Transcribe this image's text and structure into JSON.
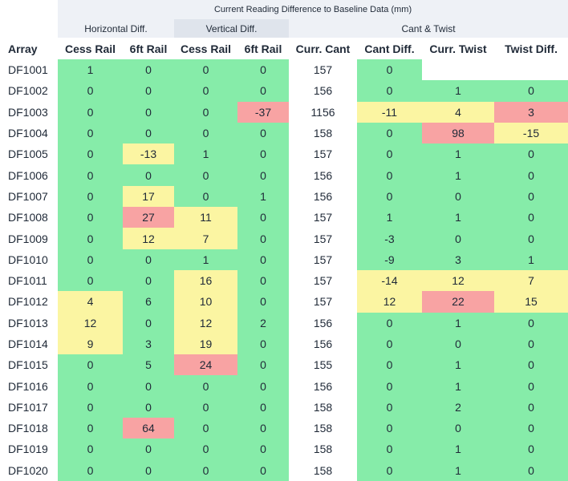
{
  "title": "Current Reading Difference to Baseline Data (mm)",
  "groups": {
    "horizontal": "Horizontal Diff.",
    "vertical": "Vertical Diff.",
    "cant_twist": "Cant & Twist"
  },
  "columns": [
    "Array",
    "Cess Rail",
    "6ft Rail",
    "Cess Rail",
    "6ft Rail",
    "Curr. Cant",
    "Cant Diff.",
    "Curr. Twist",
    "Twist Diff."
  ],
  "colors": {
    "ok": "#86eca9",
    "warn": "#fbf5a2",
    "alarm": "#f8a3a3",
    "none": "#ffffff"
  },
  "rows": [
    {
      "array": "DF1001",
      "values": [
        "1",
        "0",
        "0",
        "0",
        "157",
        "0",
        "",
        ""
      ],
      "status": [
        "g",
        "g",
        "g",
        "g",
        "w",
        "g",
        "w",
        "w"
      ]
    },
    {
      "array": "DF1002",
      "values": [
        "0",
        "0",
        "0",
        "0",
        "156",
        "0",
        "1",
        "0"
      ],
      "status": [
        "g",
        "g",
        "g",
        "g",
        "w",
        "g",
        "g",
        "g"
      ]
    },
    {
      "array": "DF1003",
      "values": [
        "0",
        "0",
        "0",
        "-37",
        "1156",
        "-11",
        "4",
        "3"
      ],
      "status": [
        "g",
        "g",
        "g",
        "r",
        "w",
        "y",
        "y",
        "r"
      ]
    },
    {
      "array": "DF1004",
      "values": [
        "0",
        "0",
        "0",
        "0",
        "158",
        "0",
        "98",
        "-15"
      ],
      "status": [
        "g",
        "g",
        "g",
        "g",
        "w",
        "g",
        "r",
        "y"
      ]
    },
    {
      "array": "DF1005",
      "values": [
        "0",
        "-13",
        "1",
        "0",
        "157",
        "0",
        "1",
        "0"
      ],
      "status": [
        "g",
        "y",
        "g",
        "g",
        "w",
        "g",
        "g",
        "g"
      ]
    },
    {
      "array": "DF1006",
      "values": [
        "0",
        "0",
        "0",
        "0",
        "156",
        "0",
        "1",
        "0"
      ],
      "status": [
        "g",
        "g",
        "g",
        "g",
        "w",
        "g",
        "g",
        "g"
      ]
    },
    {
      "array": "DF1007",
      "values": [
        "0",
        "17",
        "0",
        "1",
        "156",
        "0",
        "0",
        "0"
      ],
      "status": [
        "g",
        "y",
        "g",
        "g",
        "w",
        "g",
        "g",
        "g"
      ]
    },
    {
      "array": "DF1008",
      "values": [
        "0",
        "27",
        "11",
        "0",
        "157",
        "1",
        "1",
        "0"
      ],
      "status": [
        "g",
        "r",
        "y",
        "g",
        "w",
        "g",
        "g",
        "g"
      ]
    },
    {
      "array": "DF1009",
      "values": [
        "0",
        "12",
        "7",
        "0",
        "157",
        "-3",
        "0",
        "0"
      ],
      "status": [
        "g",
        "y",
        "y",
        "g",
        "w",
        "g",
        "g",
        "g"
      ]
    },
    {
      "array": "DF1010",
      "values": [
        "0",
        "0",
        "1",
        "0",
        "157",
        "-9",
        "3",
        "1"
      ],
      "status": [
        "g",
        "g",
        "g",
        "g",
        "w",
        "g",
        "g",
        "g"
      ]
    },
    {
      "array": "DF1011",
      "values": [
        "0",
        "0",
        "16",
        "0",
        "157",
        "-14",
        "12",
        "7"
      ],
      "status": [
        "g",
        "g",
        "y",
        "g",
        "w",
        "y",
        "y",
        "y"
      ]
    },
    {
      "array": "DF1012",
      "values": [
        "4",
        "6",
        "10",
        "0",
        "157",
        "12",
        "22",
        "15"
      ],
      "status": [
        "y",
        "g",
        "y",
        "g",
        "w",
        "y",
        "r",
        "y"
      ]
    },
    {
      "array": "DF1013",
      "values": [
        "12",
        "0",
        "12",
        "2",
        "156",
        "0",
        "1",
        "0"
      ],
      "status": [
        "y",
        "g",
        "y",
        "g",
        "w",
        "g",
        "g",
        "g"
      ]
    },
    {
      "array": "DF1014",
      "values": [
        "9",
        "3",
        "19",
        "0",
        "156",
        "0",
        "0",
        "0"
      ],
      "status": [
        "y",
        "g",
        "y",
        "g",
        "w",
        "g",
        "g",
        "g"
      ]
    },
    {
      "array": "DF1015",
      "values": [
        "0",
        "5",
        "24",
        "0",
        "155",
        "0",
        "1",
        "0"
      ],
      "status": [
        "g",
        "g",
        "r",
        "g",
        "w",
        "g",
        "g",
        "g"
      ]
    },
    {
      "array": "DF1016",
      "values": [
        "0",
        "0",
        "0",
        "0",
        "156",
        "0",
        "1",
        "0"
      ],
      "status": [
        "g",
        "g",
        "g",
        "g",
        "w",
        "g",
        "g",
        "g"
      ]
    },
    {
      "array": "DF1017",
      "values": [
        "0",
        "0",
        "0",
        "0",
        "158",
        "0",
        "2",
        "0"
      ],
      "status": [
        "g",
        "g",
        "g",
        "g",
        "w",
        "g",
        "g",
        "g"
      ]
    },
    {
      "array": "DF1018",
      "values": [
        "0",
        "64",
        "0",
        "0",
        "158",
        "0",
        "0",
        "0"
      ],
      "status": [
        "g",
        "r",
        "g",
        "g",
        "w",
        "g",
        "g",
        "g"
      ]
    },
    {
      "array": "DF1019",
      "values": [
        "0",
        "0",
        "0",
        "0",
        "158",
        "0",
        "1",
        "0"
      ],
      "status": [
        "g",
        "g",
        "g",
        "g",
        "w",
        "g",
        "g",
        "g"
      ]
    },
    {
      "array": "DF1020",
      "values": [
        "0",
        "0",
        "0",
        "0",
        "158",
        "0",
        "1",
        "0"
      ],
      "status": [
        "g",
        "g",
        "g",
        "g",
        "w",
        "g",
        "g",
        "g"
      ]
    }
  ]
}
